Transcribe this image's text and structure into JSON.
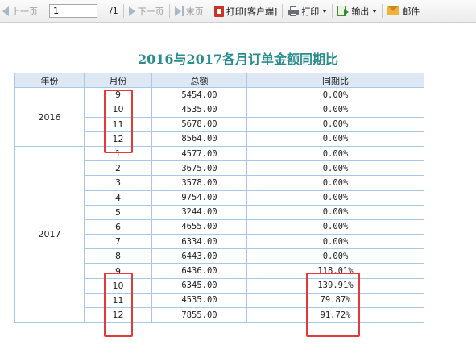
{
  "toolbar": {
    "prev_label": "上一页",
    "current_page": "1",
    "page_count": "/1",
    "next_label": "下一页",
    "last_label": "末页",
    "print_client_label": "打印[客户端]",
    "print_label": "打印",
    "export_label": "输出",
    "mail_label": "邮件"
  },
  "report": {
    "title": "2016与2017各月订单金额同期比",
    "headers": {
      "year": "年份",
      "month": "月份",
      "total": "总额",
      "yoy": "同期比"
    },
    "groups": [
      {
        "year": "2016",
        "rows": [
          {
            "month": "9",
            "total": "5454.00",
            "yoy": "0.00%"
          },
          {
            "month": "10",
            "total": "4535.00",
            "yoy": "0.00%"
          },
          {
            "month": "11",
            "total": "5678.00",
            "yoy": "0.00%"
          },
          {
            "month": "12",
            "total": "8564.00",
            "yoy": "0.00%"
          }
        ]
      },
      {
        "year": "2017",
        "rows": [
          {
            "month": "1",
            "total": "4577.00",
            "yoy": "0.00%"
          },
          {
            "month": "2",
            "total": "3675.00",
            "yoy": "0.00%"
          },
          {
            "month": "3",
            "total": "3578.00",
            "yoy": "0.00%"
          },
          {
            "month": "4",
            "total": "9754.00",
            "yoy": "0.00%"
          },
          {
            "month": "5",
            "total": "3244.00",
            "yoy": "0.00%"
          },
          {
            "month": "6",
            "total": "4655.00",
            "yoy": "0.00%"
          },
          {
            "month": "7",
            "total": "6334.00",
            "yoy": "0.00%"
          },
          {
            "month": "8",
            "total": "6443.00",
            "yoy": "0.00%"
          },
          {
            "month": "9",
            "total": "6436.00",
            "yoy": "118.01%"
          },
          {
            "month": "10",
            "total": "6345.00",
            "yoy": "139.91%"
          },
          {
            "month": "11",
            "total": "4535.00",
            "yoy": "79.87%"
          },
          {
            "month": "12",
            "total": "7855.00",
            "yoy": "91.72%"
          }
        ]
      }
    ]
  },
  "colors": {
    "title": "#2a8c8e",
    "grid": "#a9c7e6",
    "header_bg": "#dde8f4",
    "highlight": "#e23a3a"
  }
}
